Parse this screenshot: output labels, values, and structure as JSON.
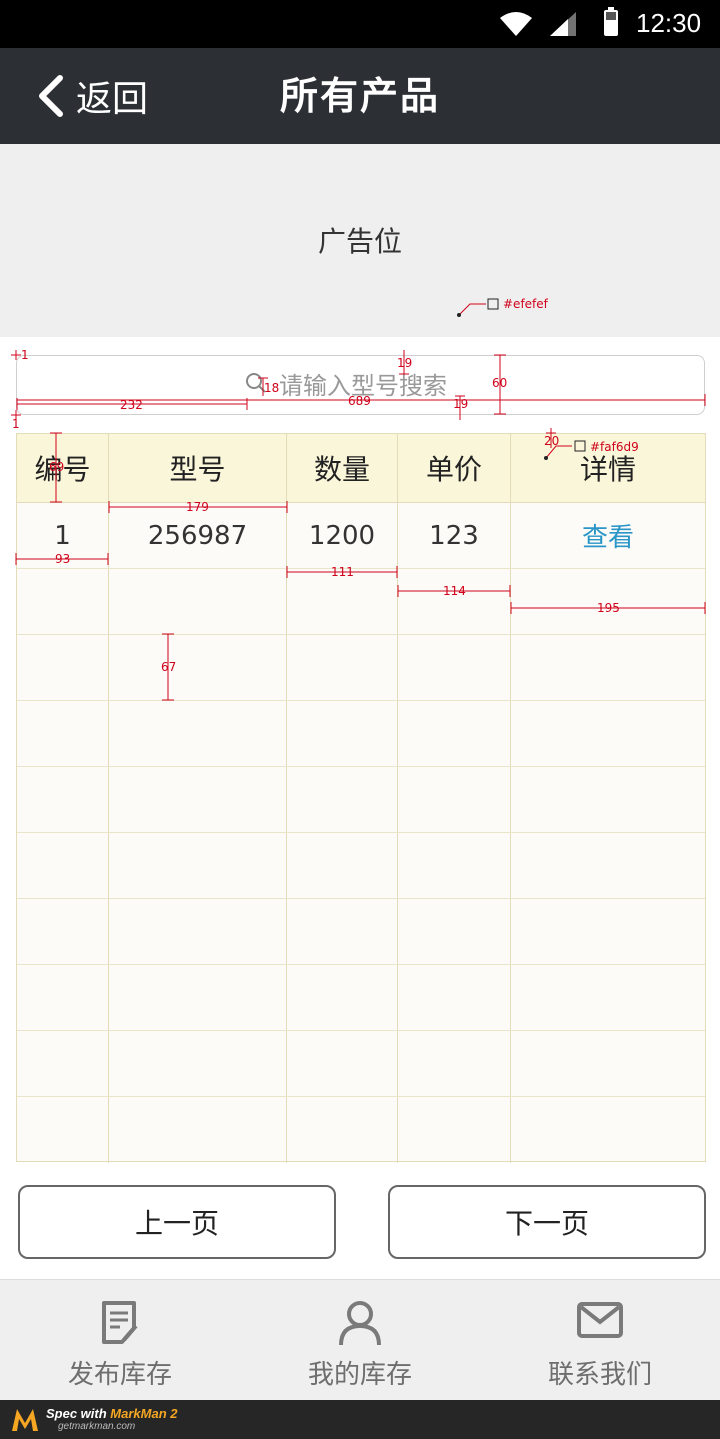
{
  "status_bar": {
    "time": "12:30",
    "icons": [
      "wifi-icon",
      "cell-signal-icon",
      "battery-icon"
    ]
  },
  "nav": {
    "back_label": "返回",
    "title": "所有产品"
  },
  "ad": {
    "label": "广告位"
  },
  "search": {
    "placeholder": "请输入型号搜索"
  },
  "table": {
    "headers": [
      "编号",
      "型号",
      "数量",
      "单价",
      "详情"
    ],
    "rows": [
      [
        "1",
        "256987",
        "1200",
        "123",
        "查看"
      ],
      [
        "",
        "",
        "",
        "",
        ""
      ],
      [
        "",
        "",
        "",
        "",
        ""
      ],
      [
        "",
        "",
        "",
        "",
        ""
      ],
      [
        "",
        "",
        "",
        "",
        ""
      ],
      [
        "",
        "",
        "",
        "",
        ""
      ],
      [
        "",
        "",
        "",
        "",
        ""
      ],
      [
        "",
        "",
        "",
        "",
        ""
      ],
      [
        "",
        "",
        "",
        "",
        ""
      ],
      [
        "",
        "",
        "",
        "",
        ""
      ]
    ]
  },
  "pager": {
    "prev_label": "上一页",
    "next_label": "下一页"
  },
  "tabbar": {
    "items": [
      {
        "label": "发布库存",
        "icon": "document-edit-icon"
      },
      {
        "label": "我的库存",
        "icon": "person-icon"
      },
      {
        "label": "联系我们",
        "icon": "mail-icon"
      }
    ]
  },
  "markman": {
    "brand_prefix": "Spec with ",
    "brand_name": "MarkMan 2",
    "site": "getmarkman.com"
  },
  "annotations": {
    "ad_color": "#efefef",
    "header_color": "#faf6d9",
    "labels": [
      "1",
      "1",
      "19",
      "60",
      "18",
      "232",
      "689",
      "19",
      "20",
      "69",
      "179",
      "93",
      "111",
      "114",
      "195",
      "67"
    ]
  },
  "colors": {
    "navbar": "#2c3034",
    "link": "#2a96c8",
    "table_header": "#faf6d9",
    "ad_background": "#efefef"
  }
}
